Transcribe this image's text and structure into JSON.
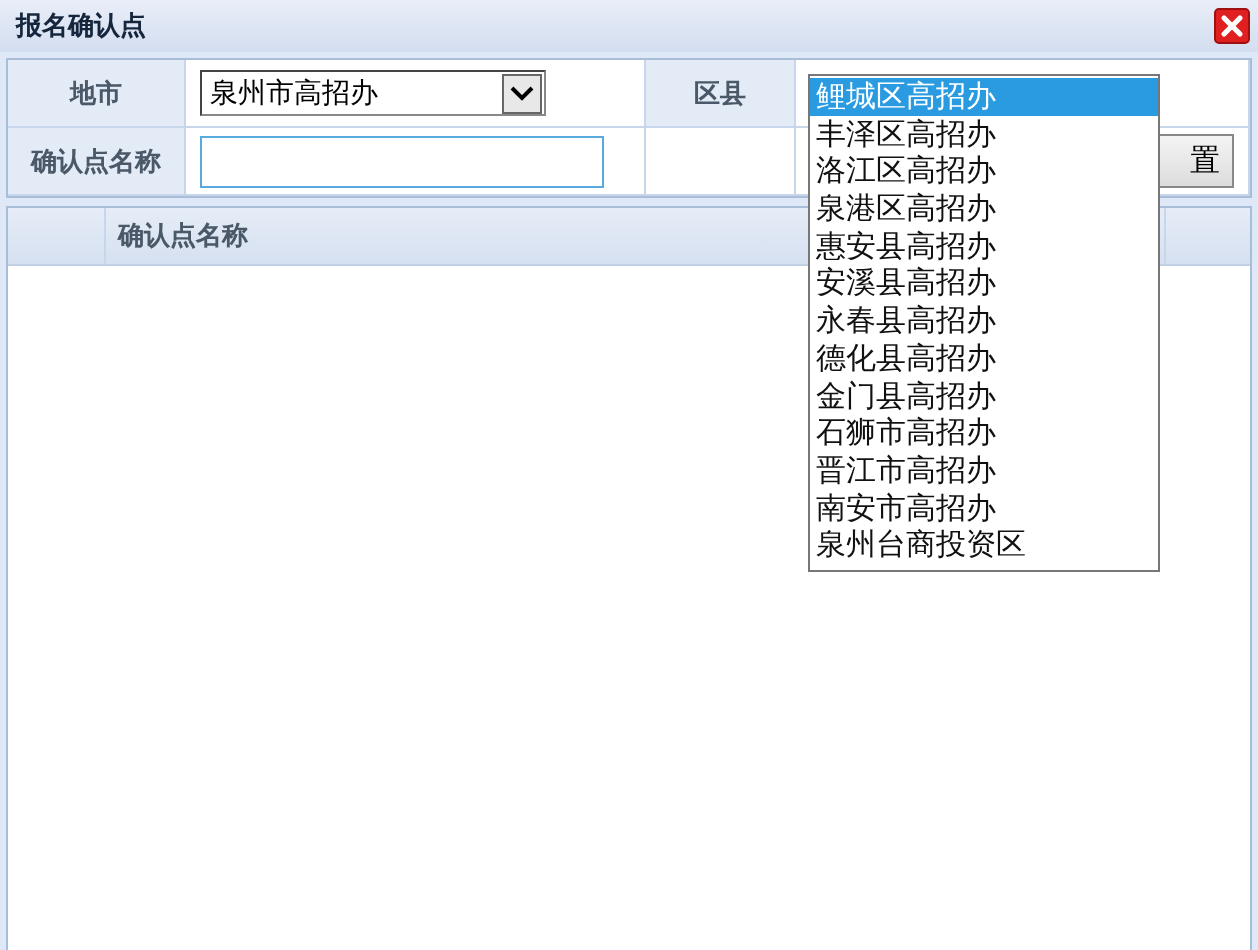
{
  "window": {
    "title": "报名确认点"
  },
  "form": {
    "city_label": "地市",
    "city_value": "泉州市高招办",
    "district_label": "区县",
    "name_label": "确认点名称",
    "reset_button": "置"
  },
  "district_options": [
    {
      "label": "鲤城区高招办",
      "selected": true
    },
    {
      "label": "丰泽区高招办",
      "selected": false
    },
    {
      "label": "洛江区高招办",
      "selected": false
    },
    {
      "label": "泉港区高招办",
      "selected": false
    },
    {
      "label": "惠安县高招办",
      "selected": false
    },
    {
      "label": "安溪县高招办",
      "selected": false
    },
    {
      "label": "永春县高招办",
      "selected": false
    },
    {
      "label": "德化县高招办",
      "selected": false
    },
    {
      "label": "金门县高招办",
      "selected": false
    },
    {
      "label": "石狮市高招办",
      "selected": false
    },
    {
      "label": "晋江市高招办",
      "selected": false
    },
    {
      "label": "南安市高招办",
      "selected": false
    },
    {
      "label": "泉州台商投资区",
      "selected": false
    }
  ],
  "table": {
    "columns": [
      "确认点名称"
    ]
  }
}
